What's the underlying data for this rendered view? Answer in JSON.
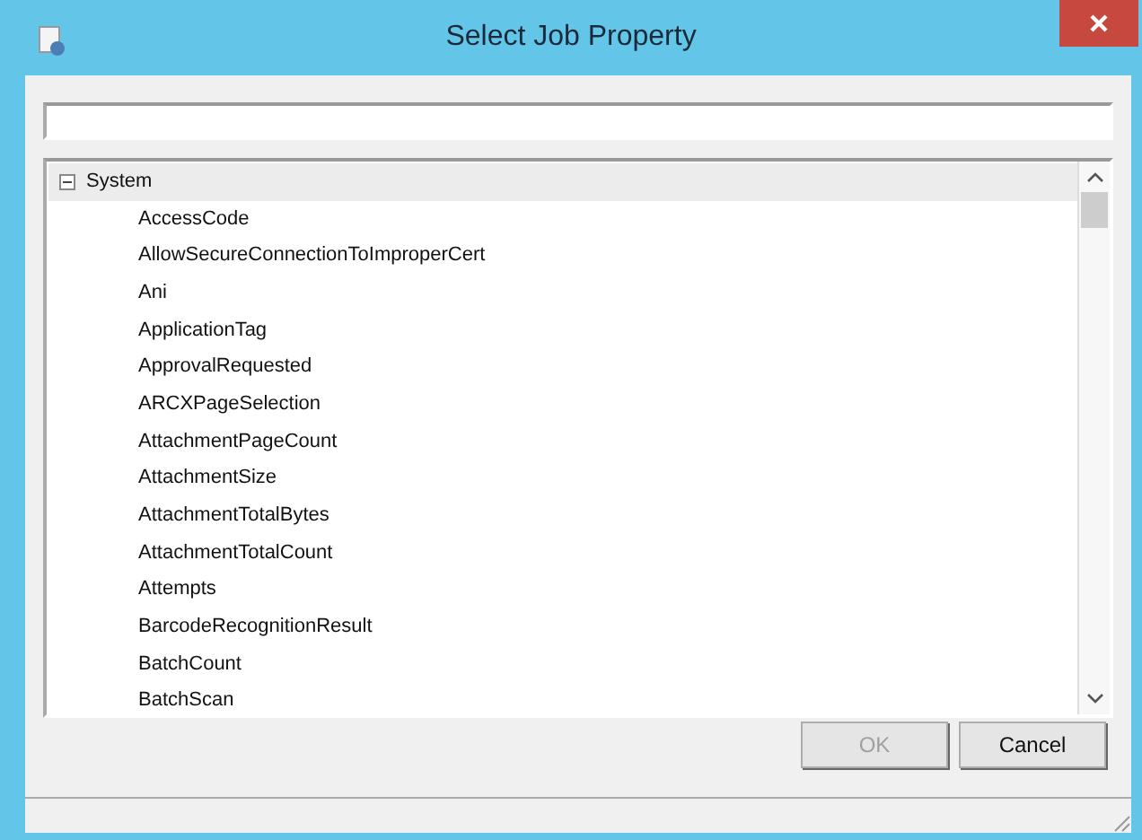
{
  "window": {
    "title": "Select Job Property"
  },
  "tree": [
    {
      "label": "System",
      "expanded": true,
      "selected": true,
      "children": [
        {
          "label": "AccessCode",
          "selected": false
        },
        {
          "label": "AllowSecureConnectionToImproperCert",
          "selected": false
        },
        {
          "label": "Ani",
          "selected": false
        },
        {
          "label": "ApplicationTag",
          "selected": false
        },
        {
          "label": "ApprovalRequested",
          "selected": false
        },
        {
          "label": "ARCXPageSelection",
          "selected": false
        },
        {
          "label": "AttachmentPageCount",
          "selected": false
        },
        {
          "label": "AttachmentSize",
          "selected": false
        },
        {
          "label": "AttachmentTotalBytes",
          "selected": false
        },
        {
          "label": "AttachmentTotalCount",
          "selected": false
        },
        {
          "label": "Attempts",
          "selected": false
        },
        {
          "label": "BarcodeRecognitionResult",
          "selected": false
        },
        {
          "label": "BatchCount",
          "selected": false
        },
        {
          "label": "BatchScan",
          "selected": false
        }
      ]
    }
  ],
  "buttons": [
    {
      "label": "OK",
      "disabled": true
    },
    {
      "label": "Cancel",
      "disabled": false
    }
  ]
}
